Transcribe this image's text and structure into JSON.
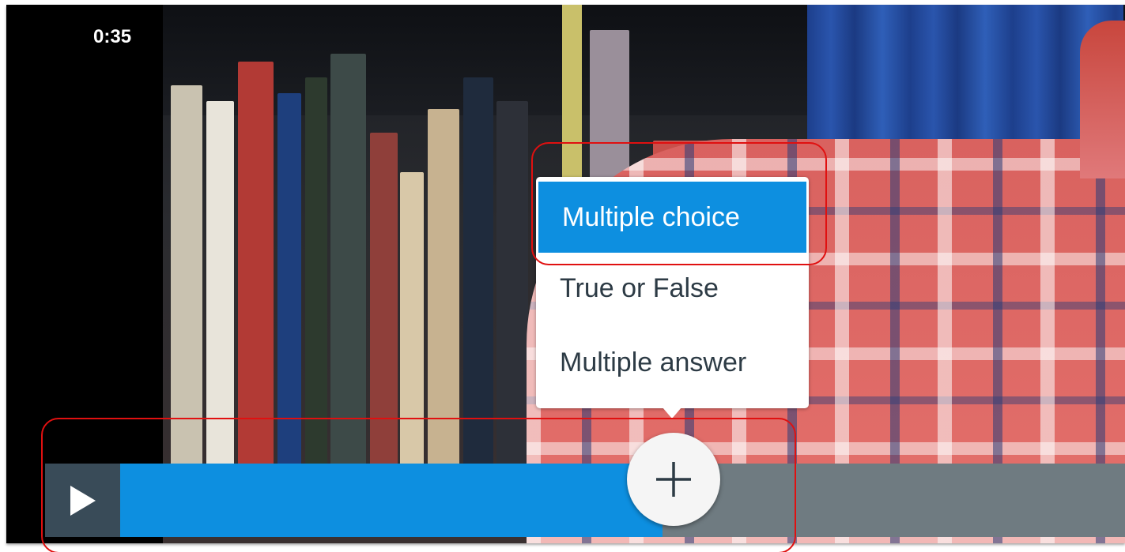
{
  "video": {
    "label": ""
  },
  "quiz_menu": {
    "items": [
      {
        "label": "Multiple choice",
        "selected": true
      },
      {
        "label": "True or False",
        "selected": false
      },
      {
        "label": "Multiple answer",
        "selected": false
      }
    ]
  },
  "player": {
    "current_time": "0:35",
    "progress_fraction": 0.5,
    "play_icon": "play-icon",
    "add_icon": "plus-icon"
  },
  "colors": {
    "accent_blue": "#0d8fe0",
    "control_dark": "#394b58",
    "control_track": "#6f7b81",
    "annotation_red": "#e01010"
  }
}
